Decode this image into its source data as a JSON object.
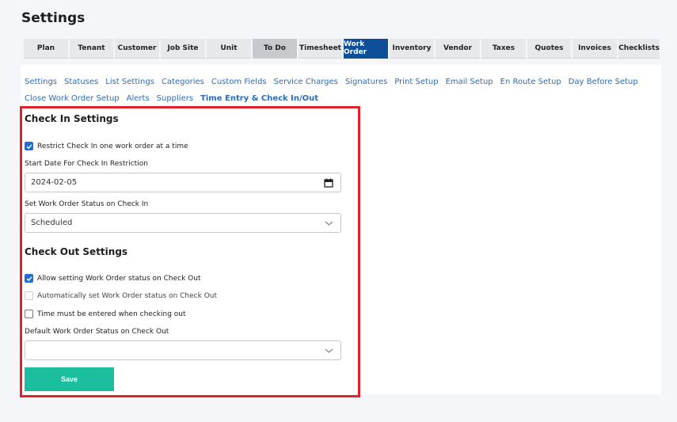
{
  "page": {
    "title": "Settings"
  },
  "tabs": [
    {
      "label": "Plan"
    },
    {
      "label": "Tenant"
    },
    {
      "label": "Customer"
    },
    {
      "label": "Job Site"
    },
    {
      "label": "Unit"
    },
    {
      "label": "To Do"
    },
    {
      "label": "Timesheet"
    },
    {
      "label": "Work Order"
    },
    {
      "label": "Inventory"
    },
    {
      "label": "Vendor"
    },
    {
      "label": "Taxes"
    },
    {
      "label": "Quotes"
    },
    {
      "label": "Invoices"
    },
    {
      "label": "Checklists"
    }
  ],
  "active_tab": "Work Order",
  "subnav": [
    {
      "label": "Settings"
    },
    {
      "label": "Statuses"
    },
    {
      "label": "List Settings"
    },
    {
      "label": "Categories"
    },
    {
      "label": "Custom Fields"
    },
    {
      "label": "Service Charges"
    },
    {
      "label": "Signatures"
    },
    {
      "label": "Print Setup"
    },
    {
      "label": "Email Setup"
    },
    {
      "label": "En Route Setup"
    },
    {
      "label": "Day Before Setup"
    },
    {
      "label": "Close Work Order Setup"
    },
    {
      "label": "Alerts"
    },
    {
      "label": "Suppliers"
    },
    {
      "label": "Time Entry & Check In/Out"
    }
  ],
  "active_subnav": "Time Entry & Check In/Out",
  "check_in": {
    "heading": "Check In Settings",
    "restrict_label": "Restrict Check In one work order at a time",
    "restrict_checked": true,
    "start_date_label": "Start Date For Check In Restriction",
    "start_date_value": "2024-02-05",
    "status_label": "Set Work Order Status on Check In",
    "status_value": "Scheduled"
  },
  "check_out": {
    "heading": "Check Out Settings",
    "allow_label": "Allow setting Work Order status on Check Out",
    "allow_checked": true,
    "auto_label": "Automatically set Work Order status on Check Out",
    "auto_checked": false,
    "time_label": "Time must be entered when checking out",
    "time_checked": false,
    "default_status_label": "Default Work Order Status on Check Out",
    "default_status_value": ""
  },
  "actions": {
    "save_label": "Save"
  },
  "colors": {
    "accent": "#0e4f9a",
    "save": "#1bbf9d",
    "highlight": "#e0222e",
    "link": "#2b6cb8"
  }
}
